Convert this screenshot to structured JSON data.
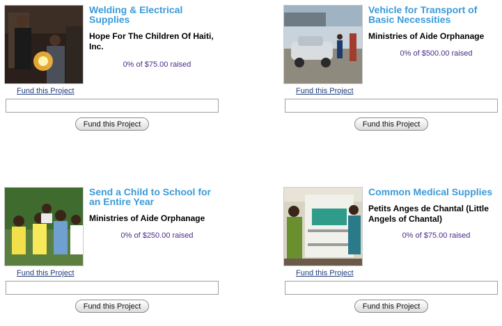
{
  "projects": [
    {
      "title": "Welding & Electrical Supplies",
      "org": "Hope For The Children Of Haiti, Inc.",
      "raised": "0% of $75.00 raised",
      "progress_percent": 0,
      "fund_link": "Fund this Project",
      "fund_button": "Fund this Project",
      "amount_value": "",
      "image_icon": "welding-photo-icon"
    },
    {
      "title": "Vehicle for Transport of Basic Necessities",
      "org": "Ministries of Aide Orphanage",
      "raised": "0% of $500.00 raised",
      "progress_percent": 0,
      "fund_link": "Fund this Project",
      "fund_button": "Fund this Project",
      "amount_value": "",
      "image_icon": "vehicle-photo-icon"
    },
    {
      "title": "Send a Child to School for an Entire Year",
      "org": "Ministries of Aide Orphanage",
      "raised": "0% of $250.00 raised",
      "progress_percent": 0,
      "fund_link": "Fund this Project",
      "fund_button": "Fund this Project",
      "amount_value": "",
      "image_icon": "schoolchildren-photo-icon"
    },
    {
      "title": "Common Medical Supplies",
      "org": "Petits Anges de Chantal (Little Angels of Chantal)",
      "raised": "0% of $75.00 raised",
      "progress_percent": 0,
      "fund_link": "Fund this Project",
      "fund_button": "Fund this Project",
      "amount_value": "",
      "image_icon": "medical-supplies-photo-icon"
    }
  ],
  "colors": {
    "title": "#3a9ad9",
    "raised": "#4a2b86",
    "link": "#1f3c7a"
  }
}
